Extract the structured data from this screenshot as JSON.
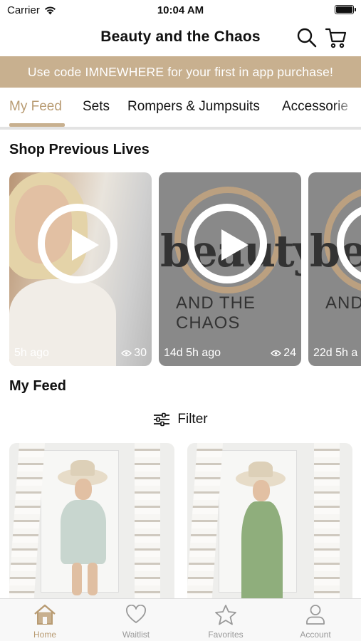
{
  "status_bar": {
    "carrier": "Carrier",
    "time": "10:04 AM"
  },
  "header": {
    "title": "Beauty and the Chaos",
    "search_icon": "search-icon",
    "cart_icon": "cart-icon"
  },
  "promo": {
    "text": "Use code IMNEWHERE for your first in app purchase!"
  },
  "tabs": [
    {
      "label": "My Feed",
      "active": true
    },
    {
      "label": "Sets"
    },
    {
      "label": "Rompers & Jumpsuits"
    },
    {
      "label": "Accessorie"
    }
  ],
  "lives": {
    "title": "Shop Previous Lives",
    "cards": [
      {
        "ago": "5h ago",
        "views": "30"
      },
      {
        "ago": "14d 5h ago",
        "views": "24",
        "logo_word": "beauty",
        "logo_sub": "AND THE CHAOS"
      },
      {
        "ago": "22d 5h a",
        "logo_word": "be",
        "logo_sub": "AND T"
      }
    ]
  },
  "feed": {
    "title": "My Feed",
    "filter_label": "Filter"
  },
  "colors": {
    "accent": "#c8b08f",
    "accent_text": "#b89b72",
    "card_gray": "#898989"
  },
  "tabbar": [
    {
      "label": "Home",
      "icon": "home-icon",
      "active": true
    },
    {
      "label": "Waitlist",
      "icon": "heart-icon"
    },
    {
      "label": "Favorites",
      "icon": "star-icon"
    },
    {
      "label": "Account",
      "icon": "person-icon"
    }
  ]
}
